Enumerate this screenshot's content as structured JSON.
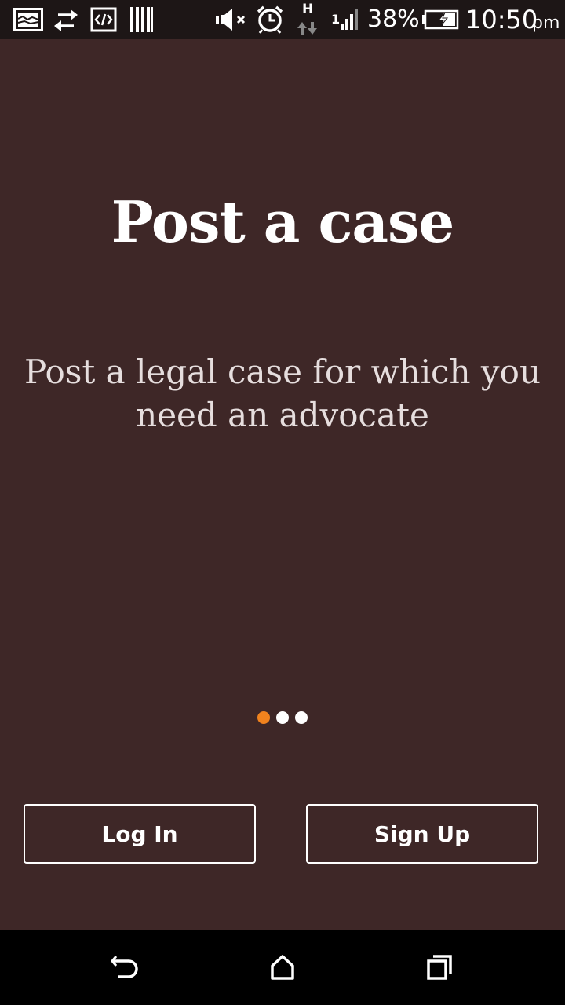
{
  "status_bar": {
    "icons": [
      "screenshot-icon",
      "sync-arrows-icon",
      "code-icon",
      "barcode-icon",
      "mute-icon",
      "alarm-icon",
      "hspa-data-icon",
      "signal-icon",
      "battery-charging-icon"
    ],
    "signal_label": "1",
    "data_label": "H",
    "battery": "38%",
    "time": "10:50",
    "ampm": "pm"
  },
  "onboarding": {
    "title": "Post a case",
    "subtitle": "Post a legal case for which you need an advocate",
    "page_count": 3,
    "active_page": 1
  },
  "actions": {
    "login_label": "Log In",
    "signup_label": "Sign Up"
  },
  "nav_bar": {
    "icons": [
      "back-icon",
      "home-icon",
      "recent-apps-icon"
    ]
  },
  "colors": {
    "background": "#3e2727",
    "status_bar": "#1d1616",
    "accent_dot": "#f0821e",
    "text": "#ffffff"
  }
}
